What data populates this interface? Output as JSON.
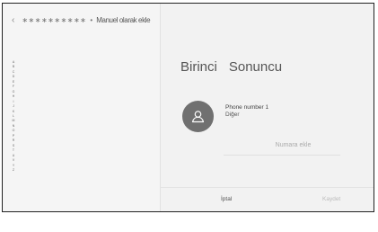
{
  "header": {
    "back_icon": "‹",
    "masked_text": "∗∗∗∗∗∗∗∗∗∗",
    "separator": "•",
    "title": "Manuel olarak ekle"
  },
  "alpha_index": [
    "A",
    "B",
    "C",
    "D",
    "E",
    "F",
    "G",
    "H",
    "I",
    "J",
    "K",
    "L",
    "M",
    "N",
    "O",
    "P",
    "R",
    "S",
    "T",
    "U",
    "V",
    "Y",
    "Z"
  ],
  "contact": {
    "first_name": "Birinci",
    "last_name": "Sonuncu",
    "phone_label": "Phone number 1",
    "phone_type": "Diğer",
    "add_number_placeholder": "Numara ekle"
  },
  "actions": {
    "cancel": "İptal",
    "save": "Kaydet"
  }
}
